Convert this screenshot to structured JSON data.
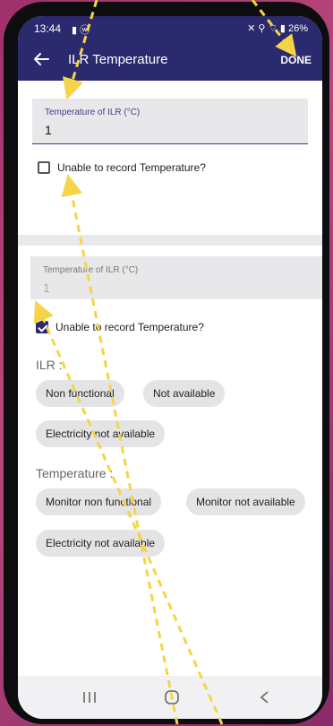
{
  "status": {
    "time": "13:44",
    "left_icons": "▮ ⓦ",
    "right_icons": "✕ ⚲ ⌔ ▮",
    "battery": "26%"
  },
  "toolbar": {
    "title": "ILR Temperature",
    "done_label": "DONE"
  },
  "top_form": {
    "field_label": "Temperature of ILR (°C)",
    "field_value": "1",
    "checkbox_label": "Unable to record Temperature?",
    "checked": false
  },
  "bottom_form": {
    "field_label": "Temperature of ILR (°C)",
    "field_value": "1",
    "checkbox_label": "Unable to record Temperature?",
    "checked": true,
    "ilr_label": "ILR :",
    "ilr_chips": [
      "Non functional",
      "Not available",
      "Electricity not available"
    ],
    "temp_label": "Temperature :",
    "temp_chips": [
      "Monitor non functional",
      "Monitor not available",
      "Electricity not available"
    ]
  },
  "colors": {
    "appbar": "#2b2a6e",
    "background": "#b8487a",
    "arrow": "#f5d547"
  },
  "nav_icons": [
    "recent-apps-icon",
    "home-icon",
    "back-icon"
  ]
}
